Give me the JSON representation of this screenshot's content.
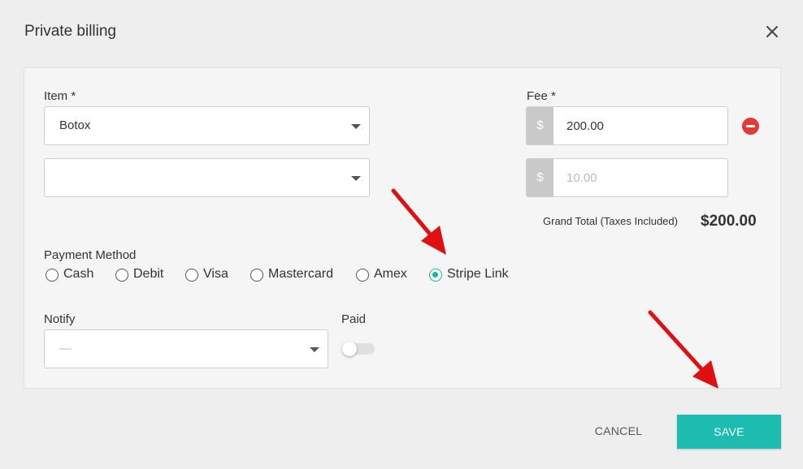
{
  "dialog": {
    "title": "Private billing"
  },
  "item": {
    "label": "Item *",
    "rows": [
      {
        "value": "Botox"
      },
      {
        "value": ""
      }
    ]
  },
  "fee": {
    "label": "Fee *",
    "currency_symbol": "$",
    "rows": [
      {
        "value": "200.00",
        "placeholder": ""
      },
      {
        "value": "",
        "placeholder": "10.00"
      }
    ]
  },
  "grand_total": {
    "label": "Grand Total (Taxes Included)",
    "value": "$200.00"
  },
  "payment_method": {
    "label": "Payment Method",
    "options": [
      "Cash",
      "Debit",
      "Visa",
      "Mastercard",
      "Amex",
      "Stripe Link"
    ],
    "selected": "Stripe Link"
  },
  "notify": {
    "label": "Notify",
    "value": "—"
  },
  "paid": {
    "label": "Paid",
    "checked": false
  },
  "actions": {
    "cancel_label": "CANCEL",
    "save_label": "SAVE"
  },
  "colors": {
    "accent": "#1dbcb0",
    "remove": "#e53935",
    "annotation_arrow": "#e01010"
  },
  "icons": {
    "close": "close-icon",
    "remove": "minus-circle-icon",
    "dropdown": "caret-down-icon"
  }
}
